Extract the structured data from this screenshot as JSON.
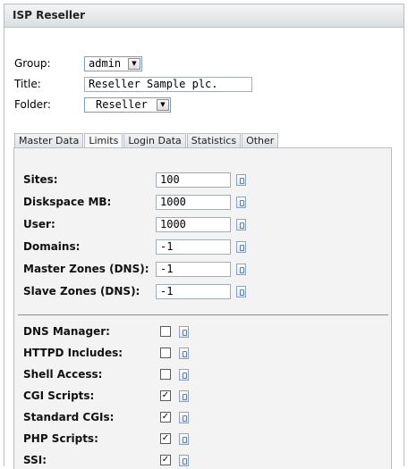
{
  "panel": {
    "title": "ISP Reseller"
  },
  "form": {
    "group_label": "Group:",
    "group_value": "admin",
    "title_label": "Title:",
    "title_value": "Reseller Sample plc.",
    "folder_label": "Folder:",
    "folder_value": "Reseller"
  },
  "tabs": [
    "Master Data",
    "Limits",
    "Login Data",
    "Statistics",
    "Other"
  ],
  "active_tab": "Limits",
  "limits": [
    {
      "label": "Sites:",
      "value": "100"
    },
    {
      "label": "Diskspace MB:",
      "value": "1000"
    },
    {
      "label": "User:",
      "value": "1000"
    },
    {
      "label": "Domains:",
      "value": "-1"
    },
    {
      "label": "Master Zones (DNS):",
      "value": "-1"
    },
    {
      "label": "Slave Zones (DNS):",
      "value": "-1"
    }
  ],
  "options": [
    {
      "label": "DNS Manager:",
      "checked": false
    },
    {
      "label": "HTTPD Includes:",
      "checked": false
    },
    {
      "label": "Shell Access:",
      "checked": false
    },
    {
      "label": "CGI Scripts:",
      "checked": true
    },
    {
      "label": "Standard CGIs:",
      "checked": true
    },
    {
      "label": "PHP Scripts:",
      "checked": true
    },
    {
      "label": "SSI:",
      "checked": true
    }
  ],
  "icons": {
    "help": "info-document-icon",
    "dropdown": "triangle-down-icon"
  },
  "colors": {
    "header_bg": "#dcdfe2",
    "border": "#b9bec4",
    "content_bg": "#f3f3f3"
  }
}
